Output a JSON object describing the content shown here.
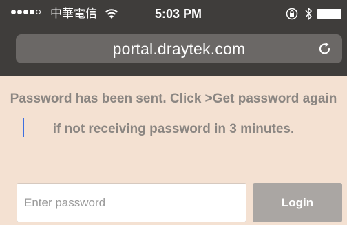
{
  "status_bar": {
    "carrier": "中華電信",
    "time": "5:03 PM",
    "signal_bars_filled": 4,
    "signal_bars_total": 5
  },
  "browser": {
    "url": "portal.draytek.com",
    "reload_icon": "reload-icon"
  },
  "page": {
    "message": "Password has been sent. Click >Get password again if not receiving password in 3 minutes.",
    "password_placeholder": "Enter password",
    "login_label": "Login"
  },
  "colors": {
    "chrome_bg": "#3f3d3b",
    "url_bar_bg": "#6b6866",
    "page_bg": "#f4e1d2",
    "message_text": "#8b8682",
    "login_button_bg": "#aaa6a3",
    "caret": "#3d6fe0"
  }
}
